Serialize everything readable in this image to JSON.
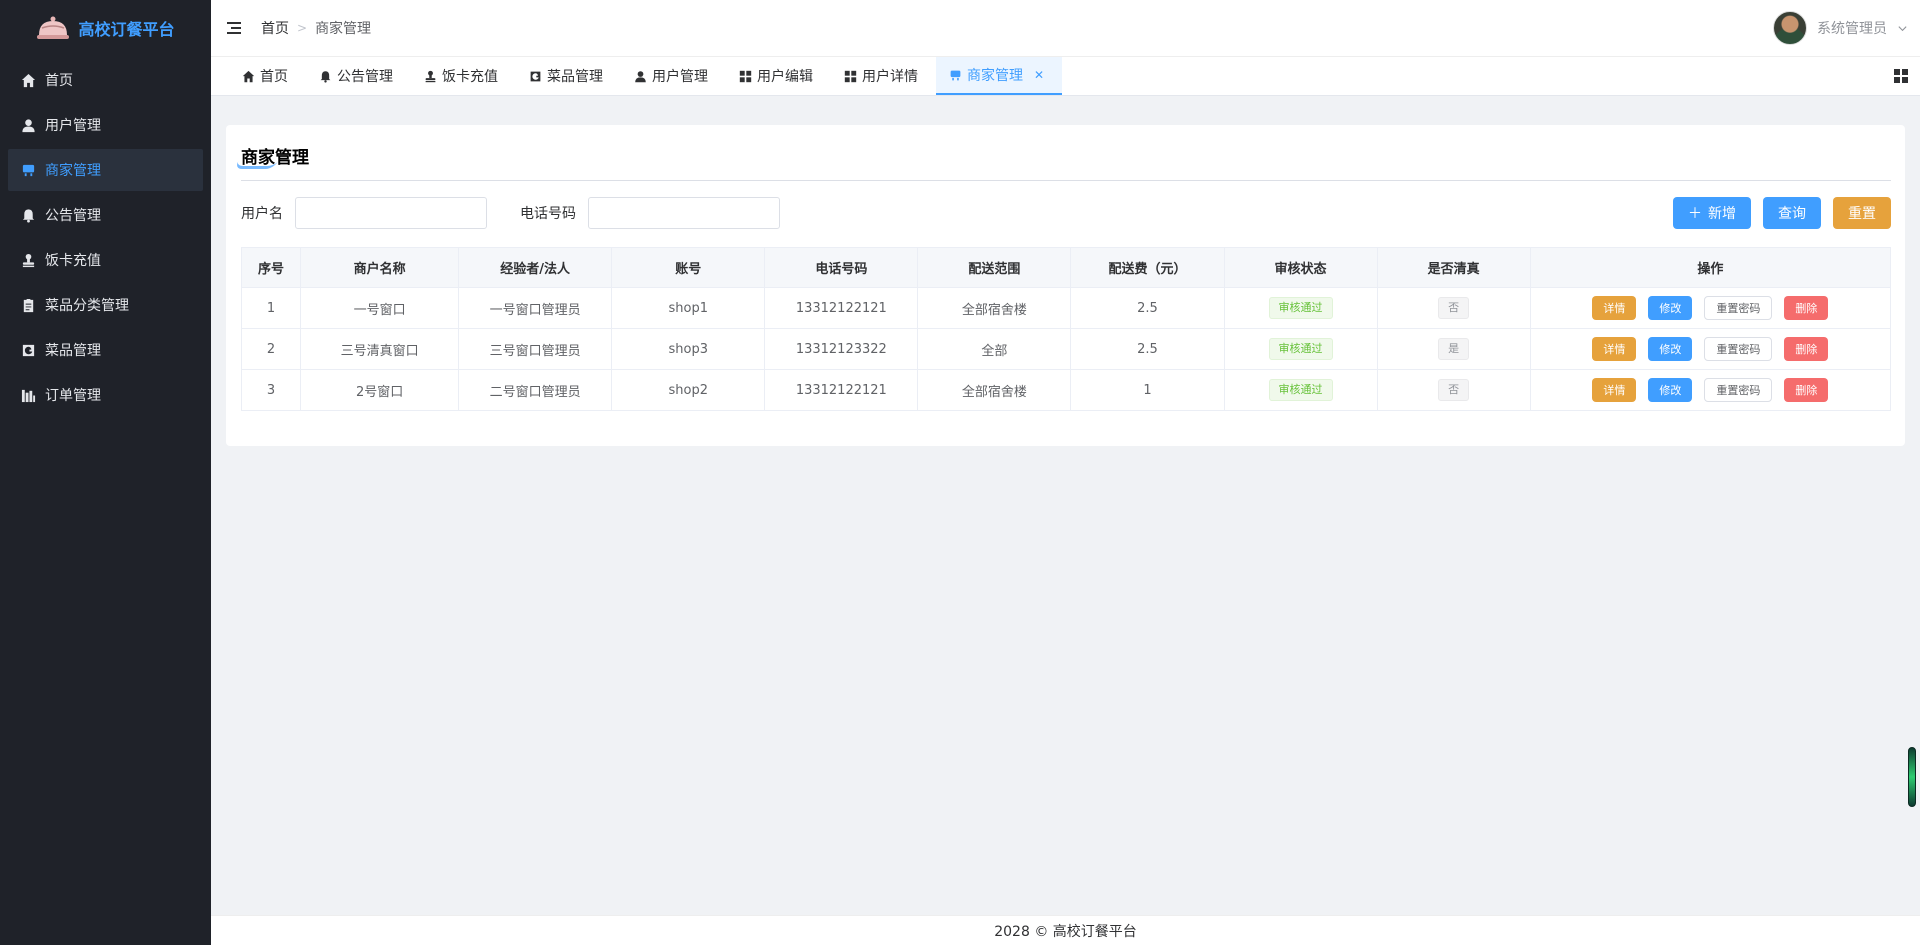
{
  "app": {
    "title": "高校订餐平台"
  },
  "sidebar": {
    "items": [
      {
        "label": "首页",
        "icon": "home-icon"
      },
      {
        "label": "用户管理",
        "icon": "user-icon"
      },
      {
        "label": "商家管理",
        "icon": "shop-icon",
        "active": true
      },
      {
        "label": "公告管理",
        "icon": "bell-icon"
      },
      {
        "label": "饭卡充值",
        "icon": "stamp-icon"
      },
      {
        "label": "菜品分类管理",
        "icon": "clipboard-icon"
      },
      {
        "label": "菜品管理",
        "icon": "dish-icon"
      },
      {
        "label": "订单管理",
        "icon": "chart-icon"
      }
    ]
  },
  "header": {
    "breadcrumb": [
      "首页",
      "商家管理"
    ],
    "user_name": "系统管理员"
  },
  "tabs": [
    {
      "label": "首页"
    },
    {
      "label": "公告管理"
    },
    {
      "label": "饭卡充值"
    },
    {
      "label": "菜品管理"
    },
    {
      "label": "用户管理"
    },
    {
      "label": "用户编辑"
    },
    {
      "label": "用户详情"
    },
    {
      "label": "商家管理",
      "active": true
    }
  ],
  "page": {
    "title": "商家管理",
    "search": {
      "username_label": "用户名",
      "username_value": "",
      "phone_label": "电话号码",
      "phone_value": "",
      "add_label": "新增",
      "query_label": "查询",
      "reset_label": "重置"
    },
    "table": {
      "columns": [
        "序号",
        "商户名称",
        "经验者/法人",
        "账号",
        "电话号码",
        "配送范围",
        "配送费（元）",
        "审核状态",
        "是否清真",
        "操作"
      ],
      "rows": [
        {
          "no": "1",
          "name": "一号窗口",
          "owner": "一号窗口管理员",
          "account": "shop1",
          "phone": "13312122121",
          "range": "全部宿舍楼",
          "fee": "2.5",
          "status": "审核通过",
          "halal": "否"
        },
        {
          "no": "2",
          "name": "三号清真窗口",
          "owner": "三号窗口管理员",
          "account": "shop3",
          "phone": "13312123322",
          "range": "全部",
          "fee": "2.5",
          "status": "审核通过",
          "halal": "是"
        },
        {
          "no": "3",
          "name": "2号窗口",
          "owner": "二号窗口管理员",
          "account": "shop2",
          "phone": "13312122121",
          "range": "全部宿舍楼",
          "fee": "1",
          "status": "审核通过",
          "halal": "否"
        }
      ],
      "actions": {
        "detail": "详情",
        "edit": "修改",
        "reset_password": "重置密码",
        "delete": "删除"
      }
    }
  },
  "footer": {
    "text": "2028 © 高校订餐平台"
  },
  "colors": {
    "primary": "#409eff",
    "warning": "#e6a23c",
    "danger": "#f56c6c",
    "success": "#67c23a",
    "sidebar_bg": "#1f2229"
  }
}
